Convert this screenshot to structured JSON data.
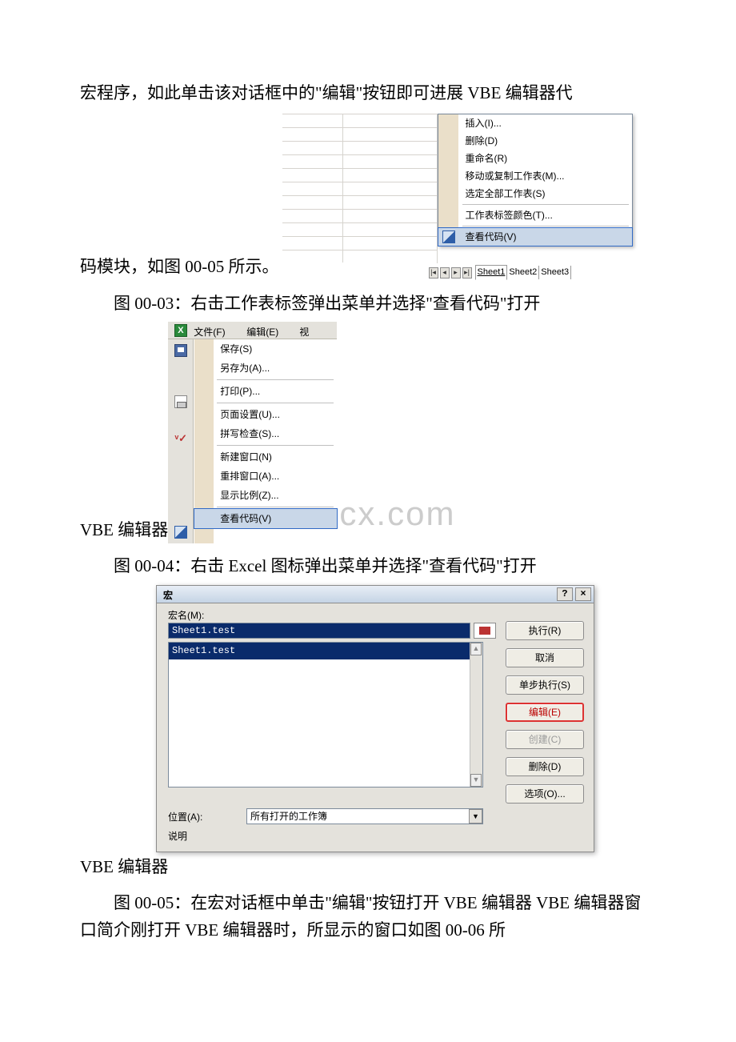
{
  "para1_prefix": "宏程序，如此单击该对话框中的\"编辑\"按钮即可进展 VBE 编辑器代",
  "para1_cont": "码模块，如图 00-05 所示。",
  "caption1": "图 00-03：右击工作表标签弹出菜单并选择\"查看代码\"打开",
  "caption2_prefix": "VBE 编辑器",
  "caption2": "图 00-04：右击 Excel 图标弹出菜单并选择\"查看代码\"打开",
  "caption3_prefix": "VBE 编辑器",
  "caption3": "图 00-05：在宏对话框中单击\"编辑\"按钮打开 VBE 编辑器 VBE 编辑器窗口简介刚打开 VBE 编辑器时，所显示的窗口如图 00-06 所",
  "watermark": "www.bdocx.com",
  "fig1": {
    "menu": {
      "insert": "插入(I)...",
      "delete": "删除(D)",
      "rename": "重命名(R)",
      "move": "移动或复制工作表(M)...",
      "selectAll": "选定全部工作表(S)",
      "tabColor": "工作表标签颜色(T)...",
      "viewCode": "查看代码(V)"
    },
    "tabs": {
      "s1": "Sheet1",
      "s2": "Sheet2",
      "s3": "Sheet3"
    }
  },
  "fig2": {
    "toolbar": {
      "file": "文件(F)",
      "edit": "编辑(E)",
      "view": "视"
    },
    "menu": {
      "save": "保存(S)",
      "saveAs": "另存为(A)...",
      "print": "打印(P)...",
      "pageSetup": "页面设置(U)...",
      "spell": "拼写检查(S)...",
      "newWindow": "新建窗口(N)",
      "arrange": "重排窗口(A)...",
      "zoom": "显示比例(Z)...",
      "viewCode": "查看代码(V)"
    }
  },
  "fig3": {
    "title": "宏",
    "nameLabel": "宏名(M):",
    "nameValue": "Sheet1.test",
    "listValue": "Sheet1.test",
    "locLabel": "位置(A):",
    "locValue": "所有打开的工作簿",
    "descLabel": "说明",
    "buttons": {
      "run": "执行(R)",
      "cancel": "取消",
      "step": "单步执行(S)",
      "edit": "编辑(E)",
      "create": "创建(C)",
      "delete": "删除(D)",
      "options": "选项(O)..."
    }
  }
}
